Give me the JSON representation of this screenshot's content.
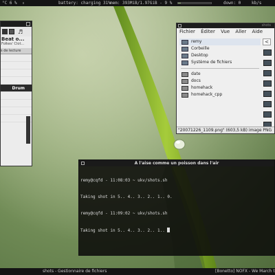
{
  "topbar": {
    "temp": "°C 6 %",
    "battery_label": "battery: charging 31%",
    "battery_level": 0.31,
    "mem_label": "mem: 393MiB/1.97GiB - 9 %",
    "mem_level": 0.09,
    "down_label": "down: 0",
    "unit": "kb/s"
  },
  "player": {
    "song_title": "Beat o...",
    "artist": "Folkes' Clot...",
    "tab_label": "s de lecture",
    "selected_track": "Drum"
  },
  "filemanager": {
    "title": "shots",
    "menu": [
      "Fichier",
      "Éditer",
      "Vue",
      "Aller",
      "Aide"
    ],
    "places": [
      "remy",
      "Corbeille",
      "Desktop",
      "Système de fichiers"
    ],
    "folders": [
      "date",
      "docs",
      "homehack",
      "homehack_cpp"
    ],
    "nav_label": "<",
    "status": "\"20071226_1109.png\" (603,5 kB) image PNG"
  },
  "terminal": {
    "title": "A l'aise comme un poisson dans l'air",
    "lines": [
      "remy@cqfd - 11:08:03 ~ ukv/shots.sh",
      "Taking shot in 5.. 4.. 3.. 2.. 1.. 0.",
      "remy@cqfd - 11:09:02 ~ ukv/shots.sh",
      "Taking shot in 5.. 4.. 3.. 2.. 1.. "
    ]
  },
  "bottombar": {
    "left": "shots - Gestionnaire de fichiers",
    "right": "[Bonetto] NOFX - We March to the"
  },
  "colors": {
    "bar_bg": "#141414",
    "wallpaper": "#7f9a62",
    "terminal_bg": "#0c0c0a"
  }
}
